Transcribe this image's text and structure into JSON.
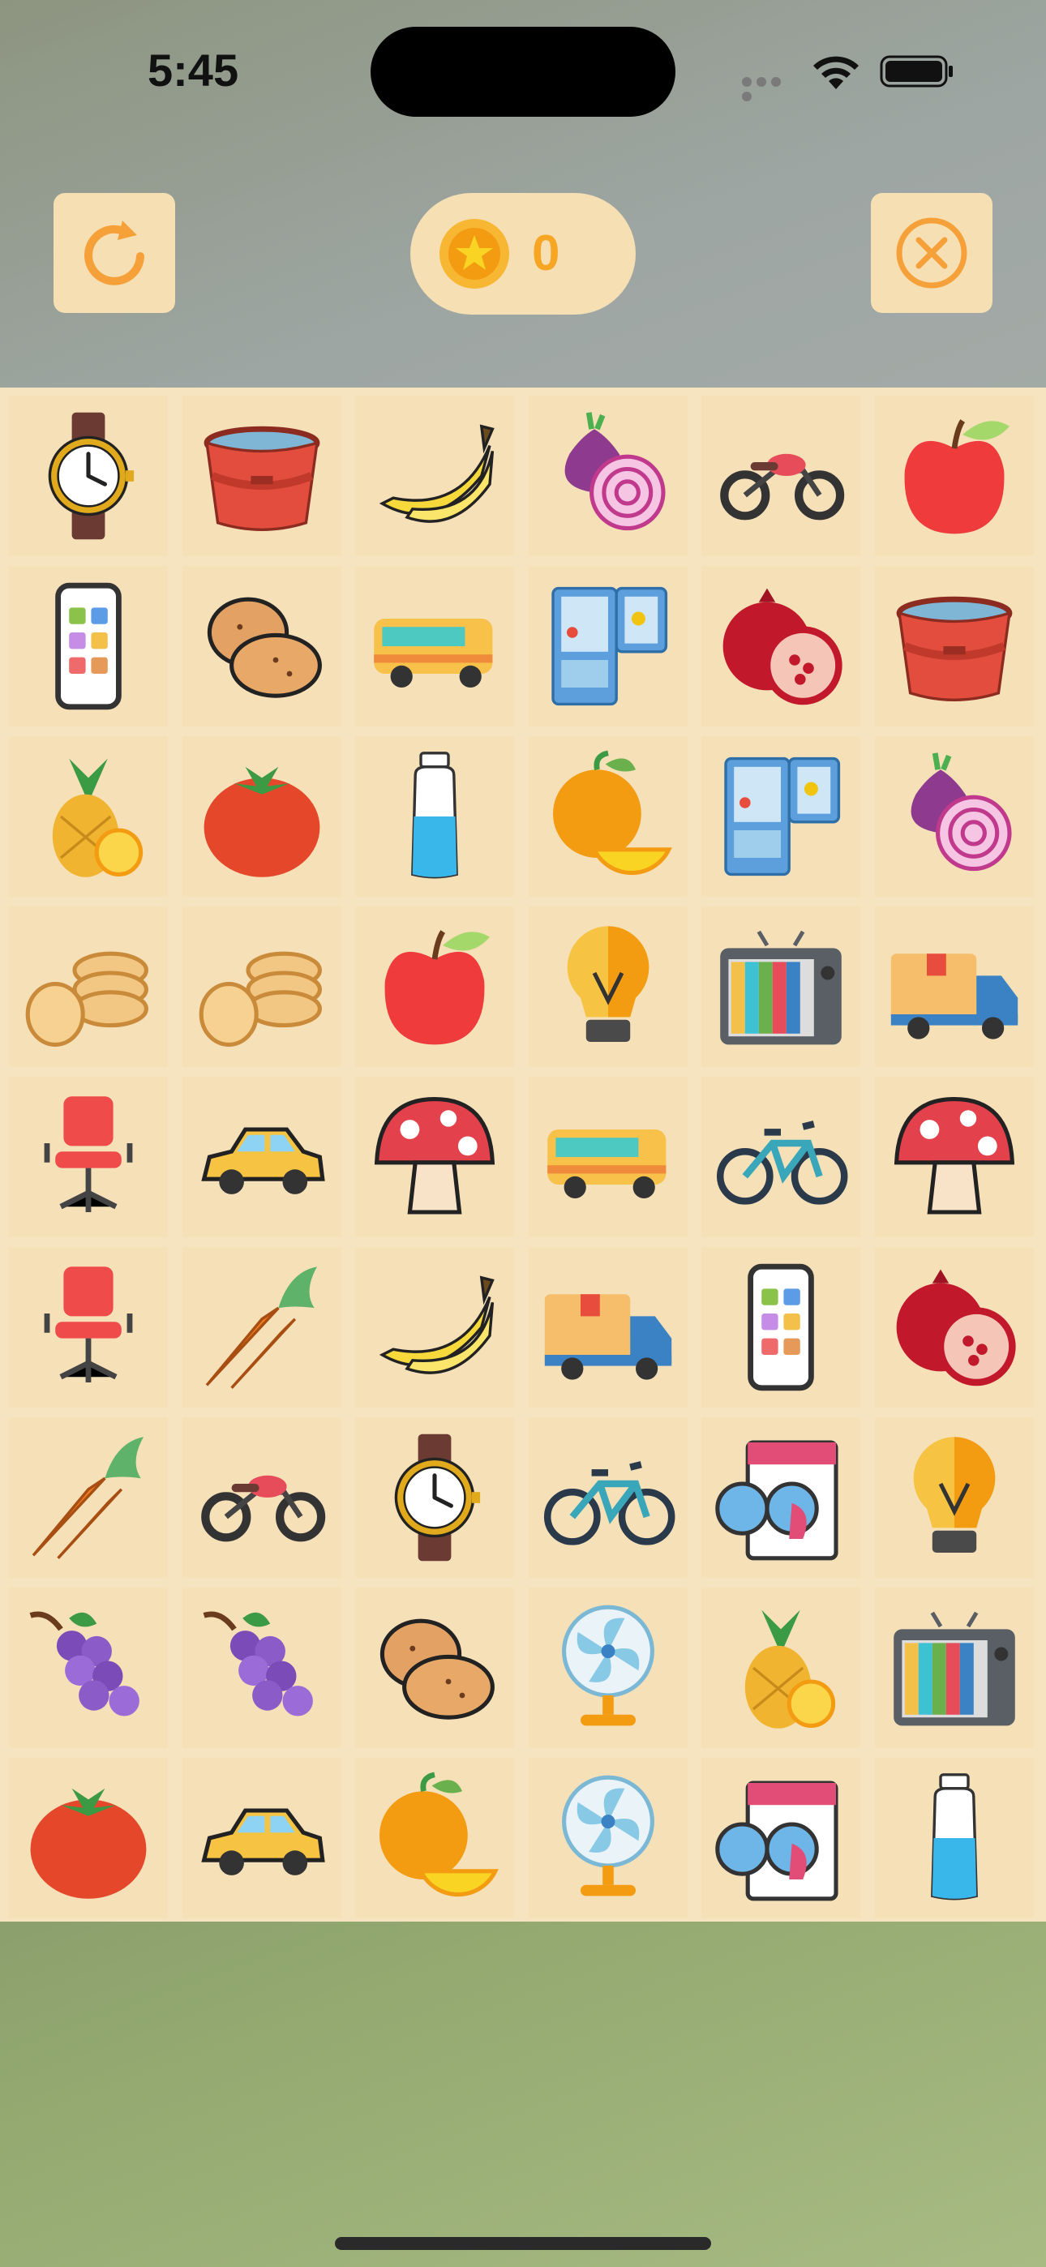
{
  "status_bar": {
    "time": "5:45"
  },
  "header": {
    "coins": "0",
    "restart_icon": "restart-icon",
    "close_icon": "close-circle-icon",
    "coin_icon": "star-coin-icon"
  },
  "board": {
    "columns": 6,
    "rows": 9,
    "tiles": [
      "watch",
      "bucket",
      "banana",
      "onion",
      "motorcycle",
      "apple",
      "phone",
      "potato",
      "bus",
      "fridge",
      "pomegranate",
      "bucket",
      "pineapple",
      "tomato",
      "water-bottle",
      "orange",
      "fridge",
      "onion",
      "crackers",
      "crackers",
      "apple",
      "light-bulb",
      "television",
      "delivery-truck",
      "office-chair",
      "car",
      "mushroom",
      "bus",
      "bicycle",
      "mushroom",
      "office-chair",
      "carrot",
      "banana",
      "delivery-truck",
      "phone",
      "pomegranate",
      "carrot",
      "motorcycle",
      "watch",
      "bicycle",
      "washing-machine",
      "light-bulb",
      "grapes",
      "grapes",
      "potato",
      "fan",
      "pineapple",
      "television",
      "tomato",
      "car",
      "orange",
      "fan",
      "washing-machine",
      "water-bottle"
    ]
  }
}
